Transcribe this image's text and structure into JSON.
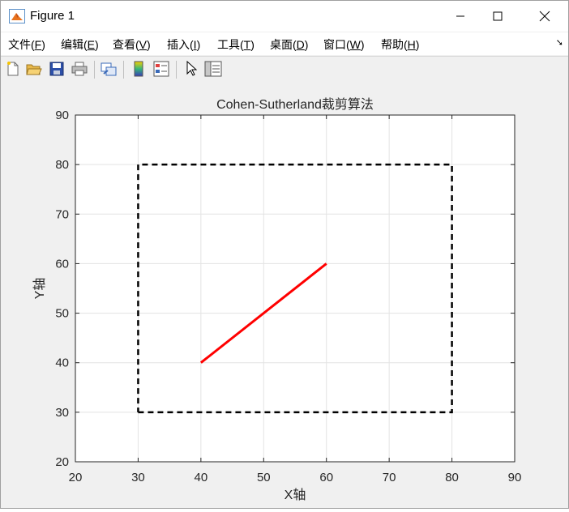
{
  "window": {
    "title": "Figure 1"
  },
  "menu": [
    {
      "label": "文件(",
      "key": "F",
      "suffix": ")"
    },
    {
      "label": "编辑(",
      "key": "E",
      "suffix": ")"
    },
    {
      "label": "查看(",
      "key": "V",
      "suffix": ")"
    },
    {
      "label": "插入(",
      "key": "I",
      "suffix": ")"
    },
    {
      "label": "工具(",
      "key": "T",
      "suffix": ")"
    },
    {
      "label": "桌面(",
      "key": "D",
      "suffix": ")"
    },
    {
      "label": "窗口(",
      "key": "W",
      "suffix": ")"
    },
    {
      "label": "帮助(",
      "key": "H",
      "suffix": ")"
    }
  ],
  "toolbar": {
    "icons": [
      "new-figure-icon",
      "open-file-icon",
      "save-icon",
      "print-icon",
      "link-plot-icon",
      "insert-colorbar-icon",
      "insert-legend-icon",
      "pointer-icon",
      "property-inspector-icon"
    ]
  },
  "chart_data": {
    "type": "line",
    "title": "Cohen-Sutherland裁剪算法",
    "xlabel": "X轴",
    "ylabel": "Y轴",
    "xlim": [
      20,
      90
    ],
    "ylim": [
      20,
      90
    ],
    "xticks": [
      20,
      30,
      40,
      50,
      60,
      70,
      80,
      90
    ],
    "yticks": [
      20,
      30,
      40,
      50,
      60,
      70,
      80,
      90
    ],
    "grid": true,
    "series": [
      {
        "style": "dashed",
        "color": "#000000",
        "x": [
          30,
          80,
          80,
          30,
          30
        ],
        "y": [
          30,
          30,
          80,
          80,
          30
        ]
      },
      {
        "style": "solid",
        "color": "#ff0000",
        "x": [
          40,
          60
        ],
        "y": [
          40,
          60
        ]
      }
    ]
  }
}
